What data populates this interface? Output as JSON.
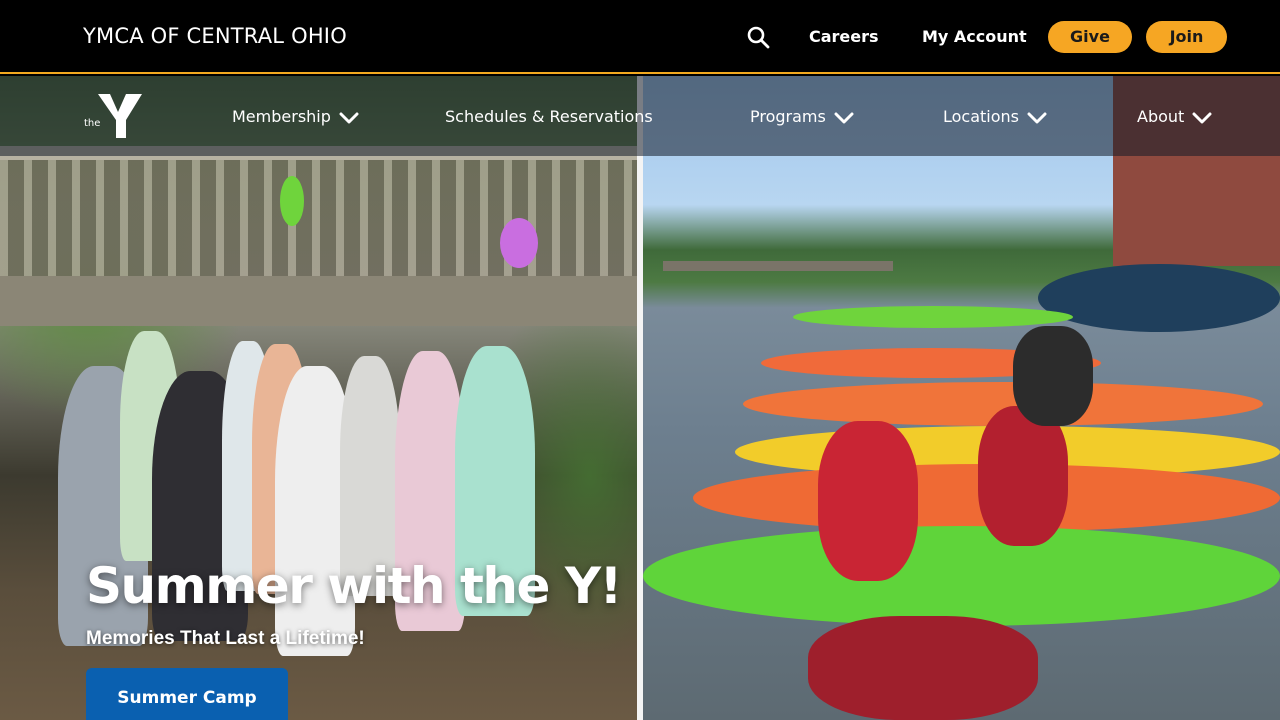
{
  "header": {
    "brand": "YMCA OF CENTRAL OHIO",
    "search_icon": "search-icon",
    "careers_label": "Careers",
    "account_label": "My Account",
    "give_label": "Give",
    "join_label": "Join",
    "accent_color": "#f6a623"
  },
  "nav": {
    "logo_text": "the",
    "items": [
      {
        "label": "Membership",
        "has_dropdown": true
      },
      {
        "label": "Schedules & Reservations",
        "has_dropdown": false
      },
      {
        "label": "Programs",
        "has_dropdown": true
      },
      {
        "label": "Locations",
        "has_dropdown": true
      },
      {
        "label": "About",
        "has_dropdown": true
      }
    ]
  },
  "hero": {
    "headline": "Summer with the Y!",
    "subhead": "Memories That Last a Lifetime!",
    "cta_label": "Summer Camp",
    "cta_color": "#0a60b0"
  }
}
